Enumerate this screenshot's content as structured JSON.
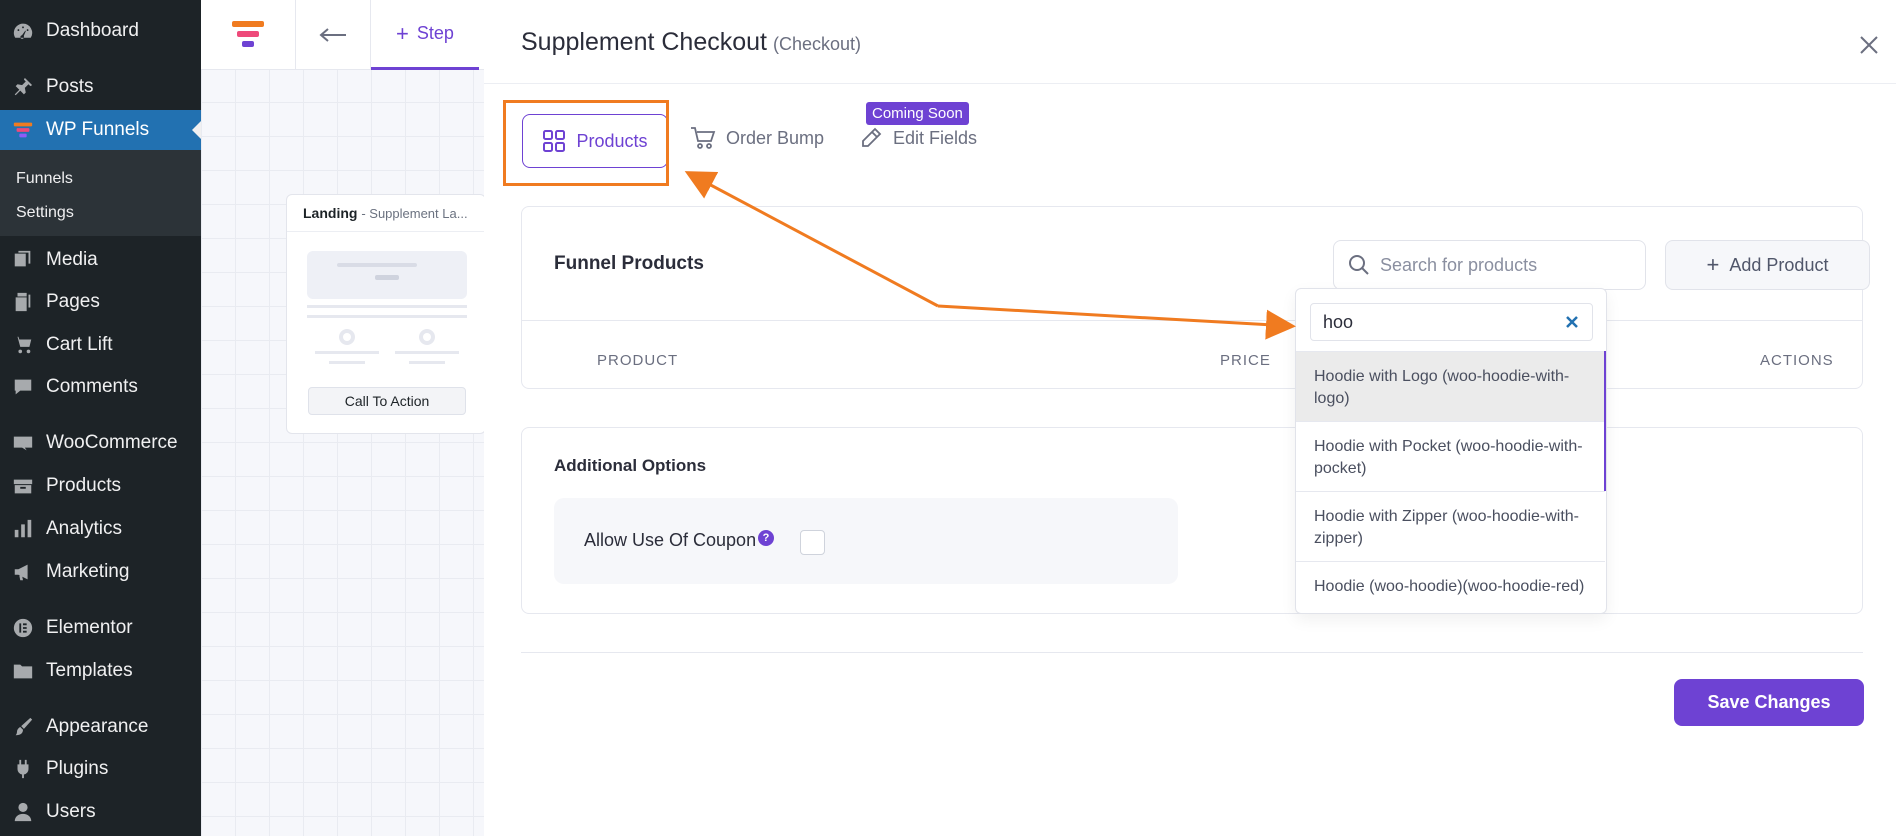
{
  "colors": {
    "accent": "#6e42d3",
    "wp_active": "#2271b1",
    "wp_sidebar": "#1d2327",
    "annotation": "#f07b20"
  },
  "wp_menu": [
    {
      "key": "dashboard",
      "label": "Dashboard",
      "icon": "dashboard-icon"
    },
    {
      "key": "posts",
      "label": "Posts",
      "icon": "pin-icon"
    },
    {
      "key": "wp-funnels",
      "label": "WP Funnels",
      "icon": "funnel-icon"
    },
    {
      "key": "media",
      "label": "Media",
      "icon": "media-icon"
    },
    {
      "key": "pages",
      "label": "Pages",
      "icon": "pages-icon"
    },
    {
      "key": "cart-lift",
      "label": "Cart Lift",
      "icon": "cart-icon"
    },
    {
      "key": "comments",
      "label": "Comments",
      "icon": "comment-icon"
    },
    {
      "key": "woocommerce",
      "label": "WooCommerce",
      "icon": "woo-icon"
    },
    {
      "key": "products",
      "label": "Products",
      "icon": "box-icon"
    },
    {
      "key": "analytics",
      "label": "Analytics",
      "icon": "bar-chart-icon"
    },
    {
      "key": "marketing",
      "label": "Marketing",
      "icon": "megaphone-icon"
    },
    {
      "key": "elementor",
      "label": "Elementor",
      "icon": "elementor-icon"
    },
    {
      "key": "templates",
      "label": "Templates",
      "icon": "folder-icon"
    },
    {
      "key": "appearance",
      "label": "Appearance",
      "icon": "brush-icon"
    },
    {
      "key": "plugins",
      "label": "Plugins",
      "icon": "plug-icon"
    },
    {
      "key": "users",
      "label": "Users",
      "icon": "user-icon"
    }
  ],
  "wp_submenu": [
    "Funnels",
    "Settings"
  ],
  "canvas": {
    "step_label": "Step",
    "node": {
      "type": "Landing",
      "name": "- Supplement La...",
      "button": "Call To Action"
    }
  },
  "panel": {
    "title": "Supplement Checkout",
    "subtitle": "(Checkout)",
    "tabs": {
      "products": "Products",
      "order_bump": "Order Bump",
      "edit_fields": "Edit Fields"
    },
    "badge": "Coming Soon",
    "funnel_products": {
      "title": "Funnel Products",
      "search_placeholder": "Search for products",
      "add_button": "Add Product",
      "columns": {
        "product": "PRODUCT",
        "price": "PRICE",
        "actions": "ACTIONS"
      }
    },
    "additional_options": {
      "title": "Additional Options",
      "coupon_label": "Allow Use Of Coupon",
      "help": "?"
    },
    "save_button": "Save Changes"
  },
  "dropdown": {
    "query": "hoo",
    "options": [
      "Hoodie with Logo (woo-hoodie-with-logo)",
      "Hoodie with Pocket (woo-hoodie-with-pocket)",
      "Hoodie with Zipper (woo-hoodie-with-zipper)",
      "Hoodie (woo-hoodie)(woo-hoodie-red)"
    ]
  }
}
